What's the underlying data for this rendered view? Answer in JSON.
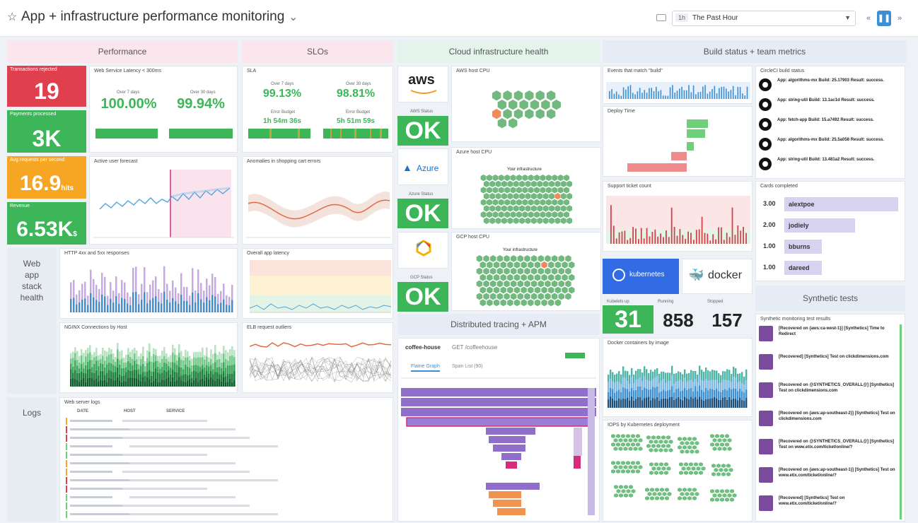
{
  "header": {
    "star_icon": "star-icon",
    "title": "App + infrastructure performance monitoring",
    "time_badge": "1h",
    "time_label": "The Past Hour",
    "prev_label": "«",
    "pause_label": "❚❚",
    "next_label": "»"
  },
  "sections": {
    "performance": "Performance",
    "slos": "SLOs",
    "cloud": "Cloud infrastructure health",
    "build": "Build status + team metrics",
    "web_app": "Web\napp\nstack\nhealth",
    "logs": "Logs",
    "tracing": "Distributed tracing + APM",
    "synthetic": "Synthetic tests"
  },
  "tiles": {
    "rejected": {
      "label": "Transactions rejected",
      "value": "19",
      "color": "#e0404d"
    },
    "processed": {
      "label": "Payments processed",
      "value": "3K",
      "color": "#3cb659"
    },
    "avg_requests": {
      "label": "Avg requests per second",
      "value": "16.9",
      "unit": "hits",
      "color": "#f6a623"
    },
    "revenue": {
      "label": "Revenue",
      "value": "6.53K",
      "unit": "$",
      "color": "#3cb659"
    }
  },
  "latency": {
    "title": "Web Service Latency < 300ms",
    "l7": "Over 7 days",
    "v7": "100.00%",
    "l30": "Over 30 days",
    "v30": "99.94%"
  },
  "sla": {
    "title": "SLA",
    "l7": "Over 7 days",
    "v7": "99.13%",
    "l30": "Over 30 days",
    "v30": "98.81%",
    "eb1_label": "Error Budget",
    "eb1": "1h 54m 36s",
    "eb2_label": "Error Budget",
    "eb2": "5h 51m 59s"
  },
  "panels": {
    "forecast": "Active user forecast",
    "anomalies": "Anomalies in shopping cart errors",
    "http": "HTTP 4xx and 5xx responses",
    "app_latency": "Overall app latency",
    "nginx": "NGINX Connections by Host",
    "elb": "ELB request outliers",
    "web_logs": "Web server logs",
    "aws_cpu": "AWS host CPU",
    "azure_cpu": "Azure host CPU",
    "gcp_cpu": "GCP host CPU",
    "events": "Events that match \"build\"",
    "deploy": "Deploy Time",
    "support": "Support ticket count",
    "circleci": "CircleCI build status",
    "cards": "Cards completed",
    "docker_img": "Docker containers by image",
    "iops": "IOPS by Kubernetes deployment",
    "synthetic_results": "Synthetic monitoring test results"
  },
  "cloud": {
    "aws_logo": "aws",
    "aws_status_label": "AWS Status",
    "azure_logo": "Azure",
    "azure_status_label": "Azure Status",
    "gcp_status_label": "GCP Status",
    "ok": "OK",
    "infra_label": "Your infrastructure"
  },
  "containers": {
    "kubernetes": "kubernetes",
    "docker": "docker",
    "running_up_label": "Kubelets up",
    "running_label": "Running",
    "stopped_label": "Stopped",
    "up_value": "31",
    "running_value": "858",
    "stopped_value": "157"
  },
  "trace": {
    "service": "coffee-house",
    "endpoint": "GET /coffeehouse",
    "tab1": "Flame Graph",
    "tab2": "Span List (90)"
  },
  "logs": {
    "col_date": "DATE",
    "col_host": "HOST",
    "col_service": "SERVICE"
  },
  "builds": [
    "App: algorithms-mx Build: 25.17903 Result: success.",
    "App: string-util Build: 13.1ac1d Result: success.",
    "App: fetch-app Build: 15.a7492 Result: success.",
    "App: algorithms-mx Build: 25.5a058 Result: success.",
    "App: string-util Build: 13.481a2 Result: success."
  ],
  "cards": [
    {
      "num": "3.00",
      "name": "alextpoe",
      "pct": 0.97
    },
    {
      "num": "2.00",
      "name": "jodiely",
      "pct": 0.6
    },
    {
      "num": "1.00",
      "name": "bburns",
      "pct": 0.32
    },
    {
      "num": "1.00",
      "name": "dareed",
      "pct": 0.32
    }
  ],
  "synthetics": [
    "[Recovered on {aws:ca-west-1}] [Synthetics] Time to Redirect",
    "[Recovered] [Synthetics] Test on clickdimensions.com",
    "[Recovered on @SYNTHETICS_OVERALL@] [Synthetics] Test on clickdimensions.com",
    "[Recovered on {aws:ap-southeast-2}] [Synthetics] Test on clickdimensions.com",
    "[Recovered on @SYNTHETICS_OVERALL@] [Synthetics] Test on www.etix.com/ticket/online/?",
    "[Recovered on {aws:ap-southeast-1}] [Synthetics] Test on www.etix.com/ticket/online/?",
    "[Recovered] [Synthetics] Test on www.etix.com/ticket/online/?"
  ],
  "colors": {
    "green": "#3cb659",
    "red": "#e0404d",
    "orange": "#f6a623",
    "purple": "#8f6fc9",
    "blue": "#3c8fd3"
  }
}
